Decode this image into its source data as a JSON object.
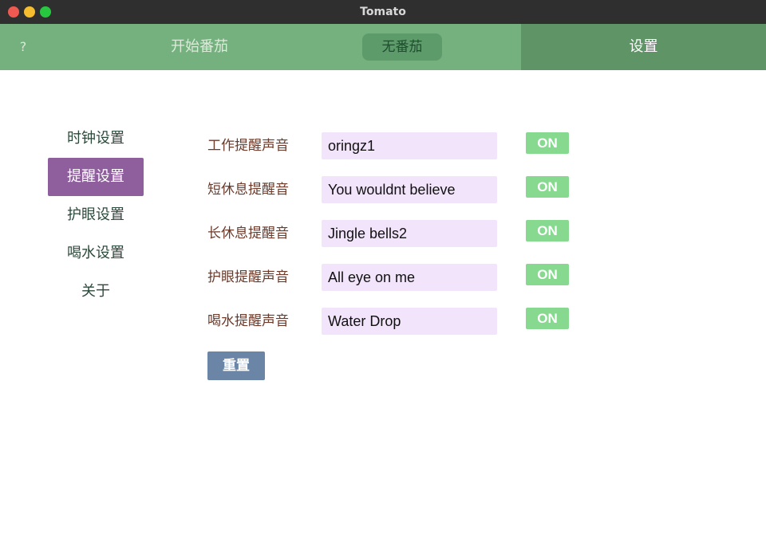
{
  "window": {
    "title": "Tomato",
    "controls": [
      "close",
      "minimize",
      "maximize"
    ]
  },
  "topnav": {
    "help_label": "?",
    "start_label": "开始番茄",
    "status_label": "无番茄",
    "settings_label": "设置"
  },
  "sidemenu": {
    "items": [
      {
        "label": "时钟设置",
        "active": false
      },
      {
        "label": "提醒设置",
        "active": true
      },
      {
        "label": "护眼设置",
        "active": false
      },
      {
        "label": "喝水设置",
        "active": false
      },
      {
        "label": "关于",
        "active": false
      }
    ]
  },
  "reminders": {
    "rows": [
      {
        "label": "工作提醒声音",
        "value": "oringz1",
        "toggle": "ON"
      },
      {
        "label": "短休息提醒音",
        "value": "You wouldnt believe",
        "toggle": "ON"
      },
      {
        "label": "长休息提醒音",
        "value": "Jingle bells2",
        "toggle": "ON"
      },
      {
        "label": "护眼提醒声音",
        "value": "All eye on me",
        "toggle": "ON"
      },
      {
        "label": "喝水提醒声音",
        "value": "Water Drop",
        "toggle": "ON"
      }
    ],
    "reset_label": "重置"
  },
  "colors": {
    "nav_bg": "#75b07f",
    "nav_active_bg": "#5f9467",
    "menu_active_bg": "#8e5e9d",
    "input_bg": "#f2e4fb",
    "toggle_on_bg": "#86d98f",
    "reset_bg": "#6a85a6"
  }
}
